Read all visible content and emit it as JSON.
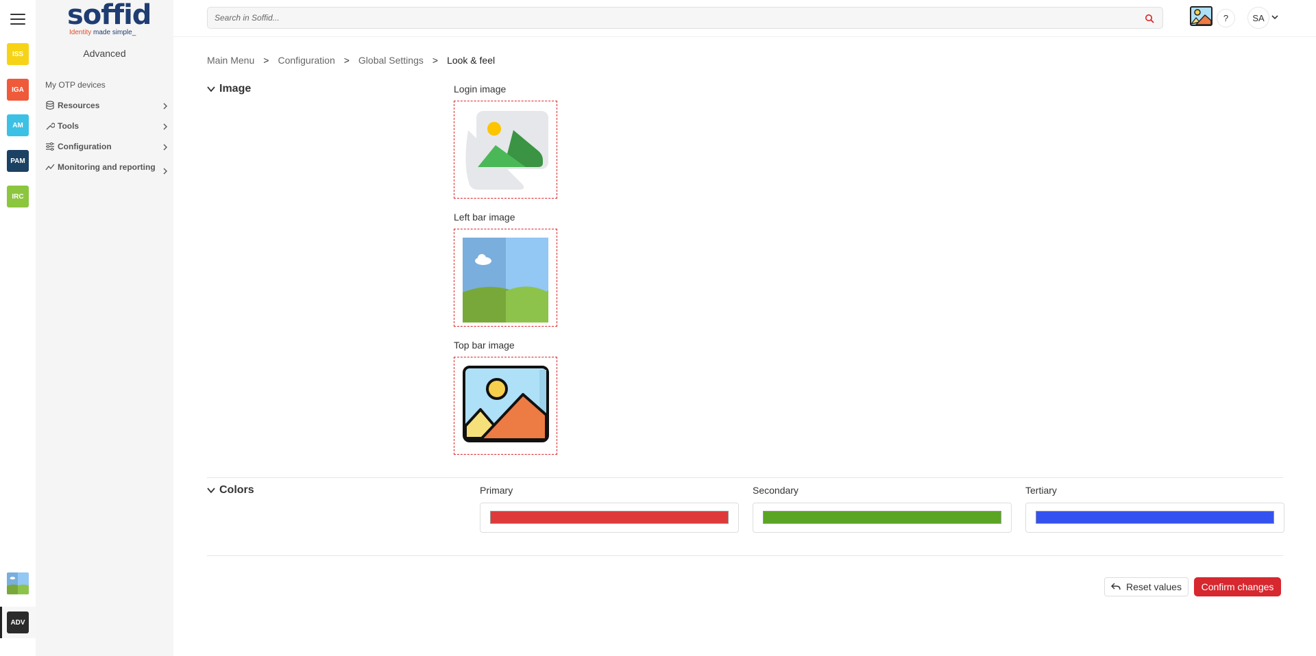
{
  "rail": {
    "apps": [
      {
        "label": "ISS",
        "color": "#f6d316",
        "text_color": "#ffffff"
      },
      {
        "label": "IGA",
        "color": "#ef5a3a",
        "text_color": "#ffffff"
      },
      {
        "label": "AM",
        "color": "#3cc1e4",
        "text_color": "#ffffff"
      },
      {
        "label": "PAM",
        "color": "#1b4163",
        "text_color": "#ffffff"
      },
      {
        "label": "IRC",
        "color": "#8cc63e",
        "text_color": "#ffffff"
      }
    ],
    "active_app": "ADV"
  },
  "sidebar": {
    "logo_word": "soffid",
    "logo_tag_highlight": "Identity",
    "logo_tag_rest": " made simple_",
    "title": "Advanced",
    "link": "My OTP devices",
    "items": [
      {
        "label": "Resources",
        "icon": "database-icon"
      },
      {
        "label": "Tools",
        "icon": "wrench-icon"
      },
      {
        "label": "Configuration",
        "icon": "sliders-icon"
      },
      {
        "label": "Monitoring and reporting",
        "icon": "chart-line-icon"
      }
    ]
  },
  "topbar": {
    "search_placeholder": "Search in Soffid...",
    "help_label": "?",
    "user_initials": "SA"
  },
  "breadcrumb": {
    "items": [
      "Main Menu",
      "Configuration",
      "Global Settings"
    ],
    "current": "Look & feel",
    "separator": ">"
  },
  "image_section": {
    "title": "Image",
    "login_label": "Login image",
    "left_bar_label": "Left bar image",
    "top_bar_label": "Top bar image"
  },
  "colors_section": {
    "title": "Colors",
    "primary_label": "Primary",
    "primary_value": "#df3a3a",
    "secondary_label": "Secondary",
    "secondary_value": "#5aa524",
    "tertiary_label": "Tertiary",
    "tertiary_value": "#3452f0"
  },
  "actions": {
    "reset_label": "Reset values",
    "confirm_label": "Confirm changes"
  }
}
